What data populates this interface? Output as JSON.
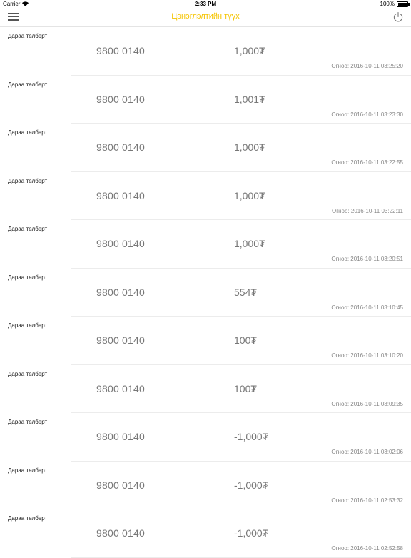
{
  "status_bar": {
    "carrier": "Carrier",
    "time": "2:33 PM",
    "battery": "100%"
  },
  "nav": {
    "title": "Цэнэглэлтийн түүх"
  },
  "transactions": [
    {
      "label": "Дараа төлбөрт",
      "phone": "9800 0140",
      "amount": "1,000₮",
      "date": "Огноо: 2016-10-11 03:25:20"
    },
    {
      "label": "Дараа төлбөрт",
      "phone": "9800 0140",
      "amount": "1,001₮",
      "date": "Огноо: 2016-10-11 03:23:30"
    },
    {
      "label": "Дараа төлбөрт",
      "phone": "9800 0140",
      "amount": "1,000₮",
      "date": "Огноо: 2016-10-11 03:22:55"
    },
    {
      "label": "Дараа төлбөрт",
      "phone": "9800 0140",
      "amount": "1,000₮",
      "date": "Огноо: 2016-10-11 03:22:11"
    },
    {
      "label": "Дараа төлбөрт",
      "phone": "9800 0140",
      "amount": "1,000₮",
      "date": "Огноо: 2016-10-11 03:20:51"
    },
    {
      "label": "Дараа төлбөрт",
      "phone": "9800 0140",
      "amount": "554₮",
      "date": "Огноо: 2016-10-11 03:10:45"
    },
    {
      "label": "Дараа төлбөрт",
      "phone": "9800 0140",
      "amount": "100₮",
      "date": "Огноо: 2016-10-11 03:10:20"
    },
    {
      "label": "Дараа төлбөрт",
      "phone": "9800 0140",
      "amount": "100₮",
      "date": "Огноо: 2016-10-11 03:09:35"
    },
    {
      "label": "Дараа төлбөрт",
      "phone": "9800 0140",
      "amount": "-1,000₮",
      "date": "Огноо: 2016-10-11 03:02:06"
    },
    {
      "label": "Дараа төлбөрт",
      "phone": "9800 0140",
      "amount": "-1,000₮",
      "date": "Огноо: 2016-10-11 02:53:32"
    },
    {
      "label": "Дараа төлбөрт",
      "phone": "9800 0140",
      "amount": "-1,000₮",
      "date": "Огноо: 2016-10-11 02:52:58"
    }
  ]
}
